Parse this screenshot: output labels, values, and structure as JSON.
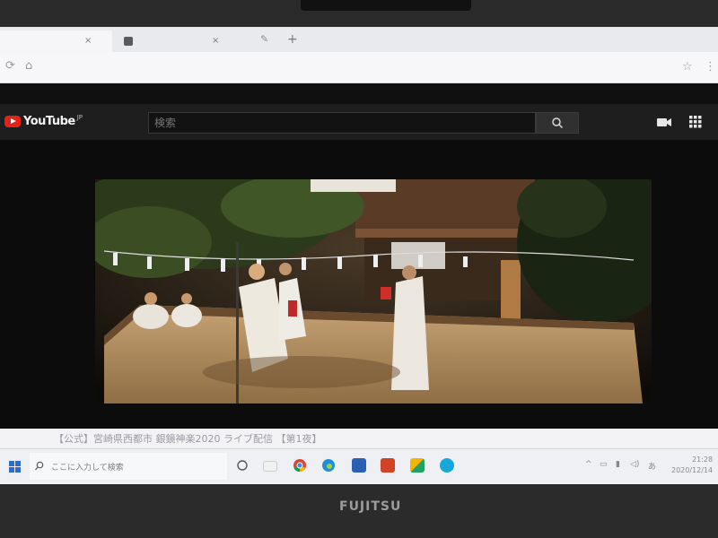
{
  "browser": {
    "tabs": [
      {
        "title": "",
        "close": "×"
      },
      {
        "title": "",
        "close": "×"
      }
    ],
    "new_tab": "+",
    "address": "",
    "icons": [
      "refresh-icon",
      "home-icon",
      "star-icon",
      "more-icon"
    ]
  },
  "youtube": {
    "logo_text": "YouTube",
    "region": "JP",
    "search_placeholder": "検索",
    "icons": [
      "search-icon",
      "create-video-icon",
      "apps-grid-icon"
    ],
    "accent": "#e62117"
  },
  "video": {
    "title": "【公式】宮崎県西都市 銀鏡神楽2020 ライブ配信 【第1夜】"
  },
  "taskbar": {
    "search_text": "ここに入力して検索",
    "time": "21:28",
    "date": "2020/12/14",
    "apps": [
      "task-view-icon",
      "chrome-icon",
      "edge-icon",
      "word-icon",
      "powerpoint-icon",
      "photos-icon",
      "skype-icon"
    ]
  },
  "device": {
    "brand": "FUJITSU"
  }
}
